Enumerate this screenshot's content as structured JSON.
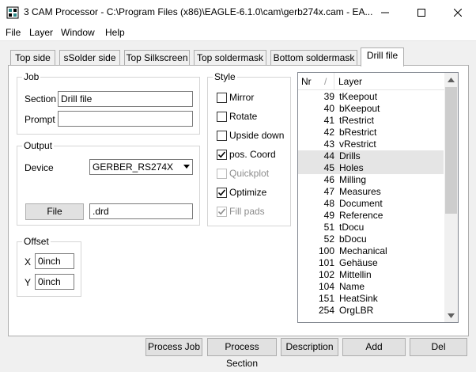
{
  "window": {
    "title": "3 CAM Processor - C:\\Program Files (x86)\\EAGLE-6.1.0\\cam\\gerb274x.cam - EA..."
  },
  "menu": [
    "File",
    "Layer",
    "Window",
    "Help"
  ],
  "tabs": [
    "Top side",
    "sSolder side",
    "Top Silkscreen",
    "Top soldermask",
    "Bottom soldermask",
    "Drill file"
  ],
  "job": {
    "group": "Job",
    "section_label": "Section",
    "section_value": "Drill file",
    "prompt_label": "Prompt",
    "prompt_value": ""
  },
  "output": {
    "group": "Output",
    "device_label": "Device",
    "device_value": "GERBER_RS274X",
    "file_button": "File",
    "file_value": ".drd"
  },
  "offset": {
    "group": "Offset",
    "x_label": "X",
    "x_value": "0inch",
    "y_label": "Y",
    "y_value": "0inch"
  },
  "style": {
    "group": "Style",
    "options": [
      {
        "label": "Mirror",
        "checked": false,
        "disabled": false
      },
      {
        "label": "Rotate",
        "checked": false,
        "disabled": false
      },
      {
        "label": "Upside down",
        "checked": false,
        "disabled": false
      },
      {
        "label": "pos. Coord",
        "checked": true,
        "disabled": false
      },
      {
        "label": "Quickplot",
        "checked": false,
        "disabled": true
      },
      {
        "label": "Optimize",
        "checked": true,
        "disabled": false
      },
      {
        "label": "Fill pads",
        "checked": true,
        "disabled": true
      }
    ]
  },
  "layers": {
    "col_nr": "Nr",
    "col_layer": "Layer",
    "rows": [
      {
        "nr": "39",
        "name": "tKeepout",
        "selected": false
      },
      {
        "nr": "40",
        "name": "bKeepout",
        "selected": false
      },
      {
        "nr": "41",
        "name": "tRestrict",
        "selected": false
      },
      {
        "nr": "42",
        "name": "bRestrict",
        "selected": false
      },
      {
        "nr": "43",
        "name": "vRestrict",
        "selected": false
      },
      {
        "nr": "44",
        "name": "Drills",
        "selected": true
      },
      {
        "nr": "45",
        "name": "Holes",
        "selected": true
      },
      {
        "nr": "46",
        "name": "Milling",
        "selected": false
      },
      {
        "nr": "47",
        "name": "Measures",
        "selected": false
      },
      {
        "nr": "48",
        "name": "Document",
        "selected": false
      },
      {
        "nr": "49",
        "name": "Reference",
        "selected": false
      },
      {
        "nr": "51",
        "name": "tDocu",
        "selected": false
      },
      {
        "nr": "52",
        "name": "bDocu",
        "selected": false
      },
      {
        "nr": "100",
        "name": "Mechanical",
        "selected": false
      },
      {
        "nr": "101",
        "name": "Gehäuse",
        "selected": false
      },
      {
        "nr": "102",
        "name": "Mittellin",
        "selected": false
      },
      {
        "nr": "104",
        "name": "Name",
        "selected": false
      },
      {
        "nr": "151",
        "name": "HeatSink",
        "selected": false
      },
      {
        "nr": "254",
        "name": "OrgLBR",
        "selected": false
      }
    ]
  },
  "buttons": [
    "Process Job",
    "Process Section",
    "Description",
    "Add",
    "Del"
  ]
}
